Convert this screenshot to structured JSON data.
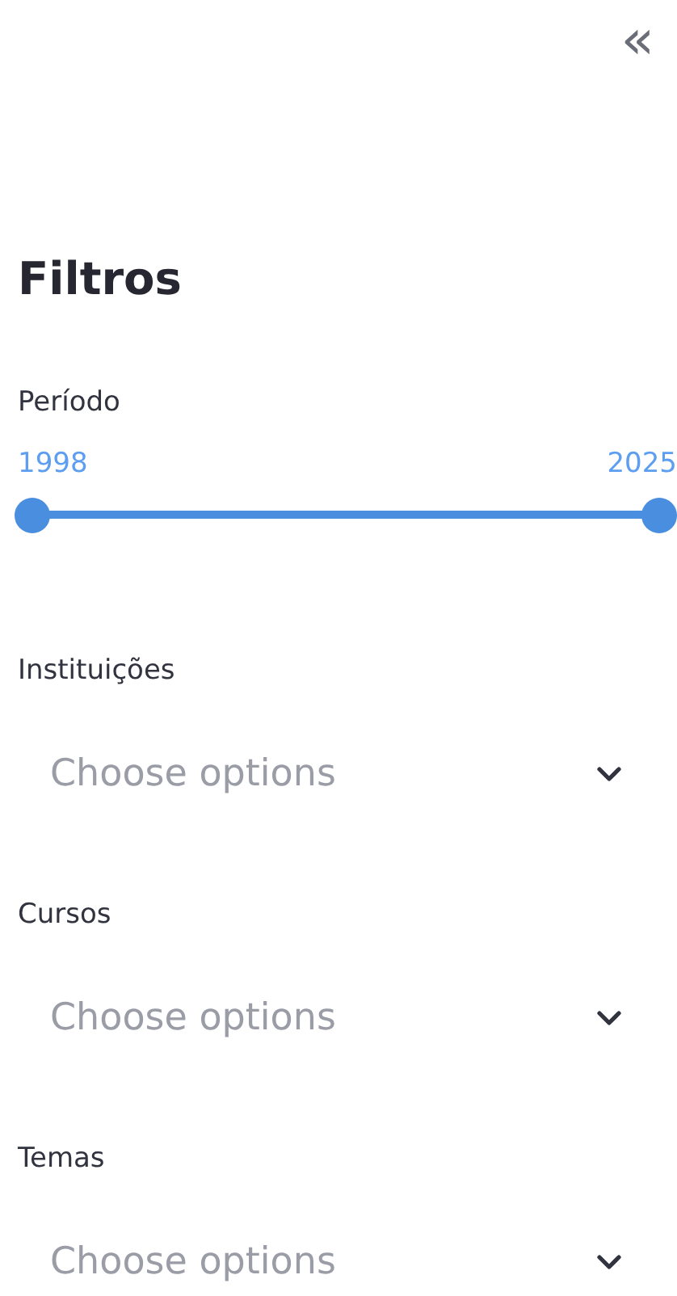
{
  "sidebar": {
    "collapse_button": "«",
    "title": "Filtros",
    "period": {
      "label": "Período",
      "min_label": "1998",
      "max_label": "2025",
      "thumbs": [
        {
          "level": 0
        },
        {
          "level": 1
        }
      ]
    },
    "filters": [
      {
        "label": "Instituições",
        "placeholder": "Choose options"
      },
      {
        "label": "Cursos",
        "placeholder": "Choose options"
      },
      {
        "label": "Temas",
        "placeholder": "Choose options"
      }
    ]
  }
}
